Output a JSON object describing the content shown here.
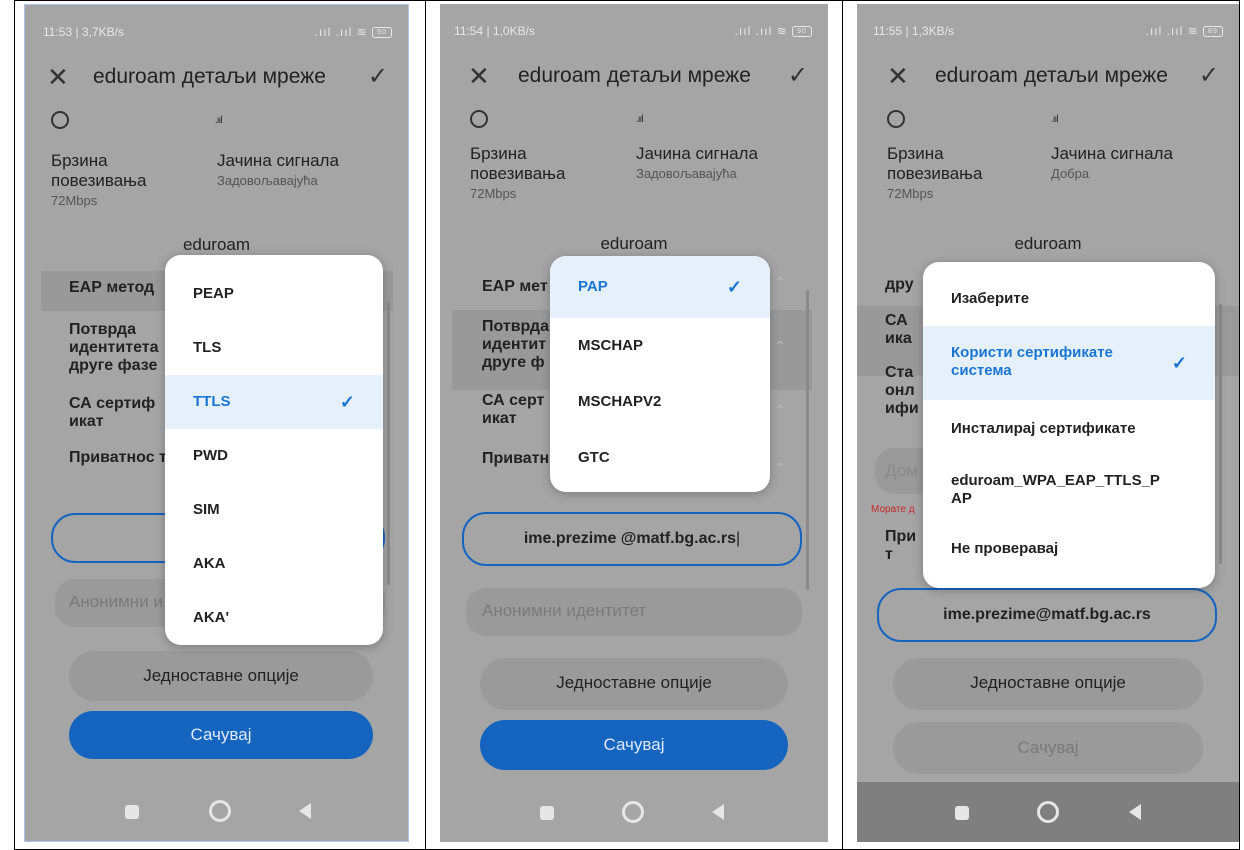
{
  "panels": [
    {
      "status": {
        "time_speed": "11:53 | 3,7KB/s",
        "battery": "90"
      },
      "header": {
        "title": "eduroam детаљи мреже"
      },
      "speed": {
        "label": "Брзина повезивања",
        "value": "72Mbps"
      },
      "signal": {
        "label": "Јачина сигнала",
        "value": "Задовољавајућа"
      },
      "network_name": "eduroam",
      "rows": [
        "ЕАР метод",
        "Потврда идентитета друге фазе",
        "СА сертиф икат",
        "Приватнос т"
      ],
      "anon_placeholder": "Анонимни и",
      "simple_options": "Једноставне опције",
      "save": "Сачувај",
      "dropdown": {
        "options": [
          "PEAP",
          "TLS",
          "TTLS",
          "PWD",
          "SIM",
          "AKA",
          "AKA'"
        ],
        "selected": "TTLS"
      }
    },
    {
      "status": {
        "time_speed": "11:54 | 1,0KB/s",
        "battery": "90"
      },
      "header": {
        "title": "eduroam детаљи мреже"
      },
      "speed": {
        "label": "Брзина повезивања",
        "value": "72Mbps"
      },
      "signal": {
        "label": "Јачина сигнала",
        "value": "Задовољавајућа"
      },
      "network_name": "eduroam",
      "rows": [
        "ЕАР мет",
        "Потврда идентит друге ф",
        "СА серт икат",
        "Приватн т"
      ],
      "identity_value": "ime.prezime @matf.bg.ac.rs",
      "anon_placeholder": "Анонимни идентитет",
      "simple_options": "Једноставне опције",
      "save": "Сачувај",
      "dropdown": {
        "options": [
          "PAP",
          "MSCHAP",
          "MSCHAPV2",
          "GTC"
        ],
        "selected": "PAP"
      }
    },
    {
      "status": {
        "time_speed": "11:55 | 1,3KB/s",
        "battery": "89"
      },
      "header": {
        "title": "eduroam детаљи мреже"
      },
      "speed": {
        "label": "Брзина повезивања",
        "value": "72Mbps"
      },
      "signal": {
        "label": "Јачина сигнала",
        "value": "Добра"
      },
      "network_name": "eduroam",
      "rows": [
        "дру",
        "СА ика",
        "Ста онл ифи",
        "Дом",
        "При т"
      ],
      "error": "Морате д",
      "identity_value": "ime.prezime@matf.bg.ac.rs",
      "simple_options": "Једноставне опције",
      "save": "Сачувај",
      "dropdown": {
        "options": [
          "Изаберите",
          "Користи сертификате система",
          "Инсталирај сертификате",
          "eduroam_WPA_EAP_TTLS_PAP",
          "Не проверавај"
        ],
        "selected": "Користи сертификате система"
      }
    }
  ]
}
